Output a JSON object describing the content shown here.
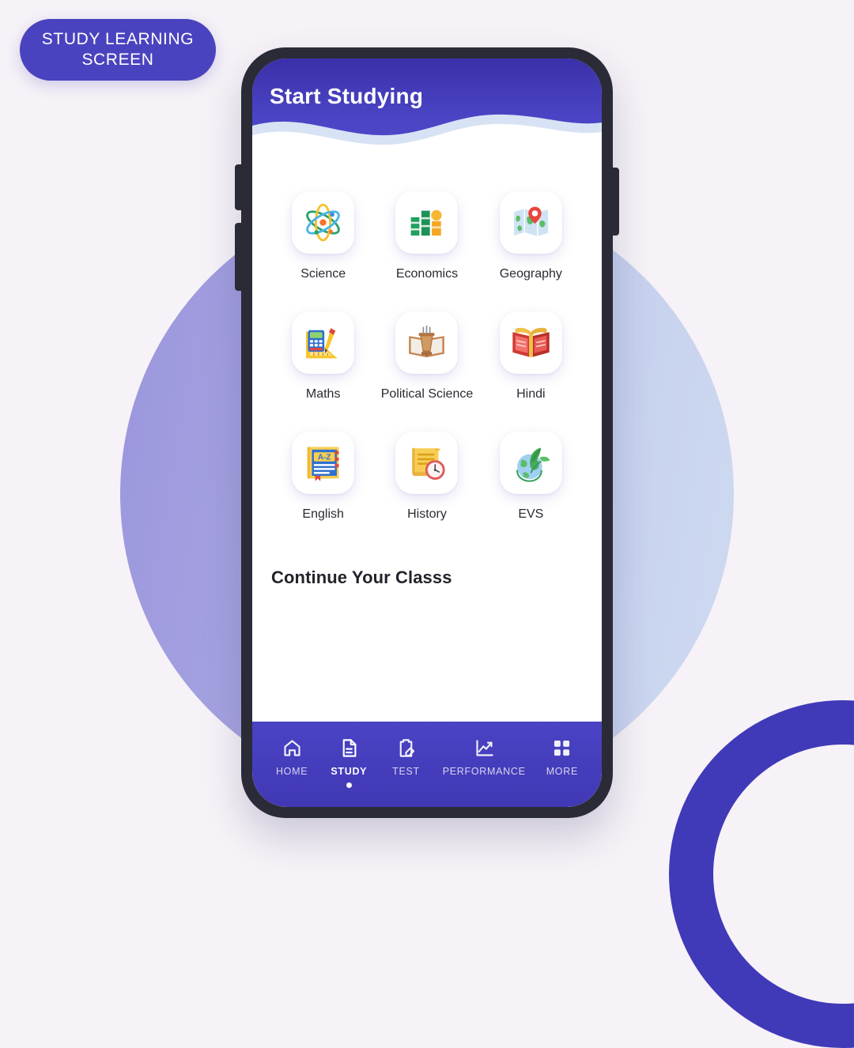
{
  "badge": {
    "label": "STUDY LEARNING SCREEN"
  },
  "header": {
    "title": "Start Studying"
  },
  "subjects": [
    {
      "label": "Science",
      "icon": "atom-icon"
    },
    {
      "label": "Economics",
      "icon": "money-stacks-icon"
    },
    {
      "label": "Geography",
      "icon": "map-pin-icon"
    },
    {
      "label": "Maths",
      "icon": "calculator-ruler-icon"
    },
    {
      "label": "Political Science",
      "icon": "podium-book-icon"
    },
    {
      "label": "Hindi",
      "icon": "open-book-icon"
    },
    {
      "label": "English",
      "icon": "dictionary-book-icon"
    },
    {
      "label": "History",
      "icon": "scroll-clock-icon"
    },
    {
      "label": "EVS",
      "icon": "globe-leaf-icon"
    }
  ],
  "section": {
    "continue_title": "Continue Your Classs"
  },
  "bottom_nav": {
    "items": [
      {
        "label": "HOME",
        "icon": "home-icon",
        "active": false
      },
      {
        "label": "STUDY",
        "icon": "document-icon",
        "active": true
      },
      {
        "label": "TEST",
        "icon": "clipboard-pencil-icon",
        "active": false
      },
      {
        "label": "PERFORMANCE",
        "icon": "chart-line-icon",
        "active": false
      },
      {
        "label": "MORE",
        "icon": "grid-icon",
        "active": false
      }
    ]
  },
  "colors": {
    "brand_purple": "#4a43bf",
    "header_purple": "#4b45c6",
    "page_background": "#f6f2f7",
    "wave_light": "#d7e3f4",
    "label_text": "#2a2a33"
  }
}
